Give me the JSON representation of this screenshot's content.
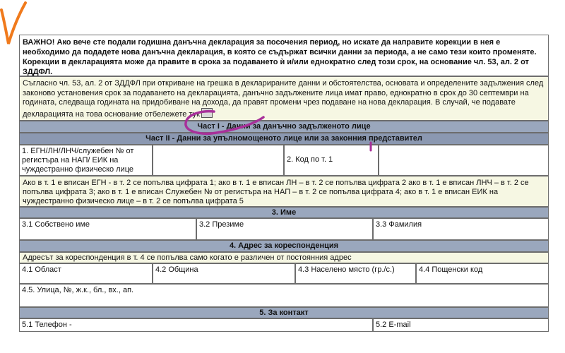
{
  "important": {
    "text": "ВАЖНО! Ако вече сте подали годишна данъчна декларация за посочения период, но искате да направите корекции в нея е необходимо да подадете нова данъчна декларация, в която се съдържат всички данни за периода, а не само тези които променяте. Корекции в декларацията може да правите в срока за подаването ѝ и/или еднократно след този срок, на основание чл. 53, ал. 2 от ЗДДФЛ."
  },
  "notice": {
    "text": "Съгласно чл. 53, ал. 2 от ЗДДФЛ при откриване на грешка в декларираните данни и обстоятелства, основата и определените задължения след законово установения срок за подаването на декларацията, данъчно задължените лица имат право, еднократно в срок до 30 септември на годината, следваща годината на придобиване на дохода, да правят промени чрез подаване на нова декларация. В случай, че подавате декларацията на това основание отбележете тук"
  },
  "headers": {
    "part1": "Част I - Данни за данъчно задълженото лице",
    "part2": "Част II - Данни за упълномощеното лице или за законния представител",
    "name": "3. Име",
    "address": "4. Адрес за кореспонденция",
    "contact": "5. За контакт"
  },
  "fields": {
    "egn_label": "1. ЕГН/ЛН/ЛНЧ/служебен № от регистъра на НАП/ ЕИК на чуждестранно физическо лице",
    "code_label": "2. Код по т. 1",
    "code_hint": "Ако в т. 1 е вписан ЕГН - в т. 2 се попълва цифрата 1; ако в т. 1 е вписан ЛН – в т. 2 се попълва цифрата 2 ако в т. 1 е вписан ЛНЧ – в т. 2 се попълва цифрата 3; ако в т. 1 е вписан Служебен № от регистъра на НАП – в т. 2 се попълва цифрата 4; ако в т. 1 е вписан ЕИК на чуждестранно физическо лице – в т. 2 се попълва цифрата 5",
    "first_name": "3.1 Собствено име",
    "middle_name": "3.2 Презиме",
    "last_name": "3.3 Фамилия",
    "address_hint": "Адресът за кореспонденция в т. 4 се попълва само когато е различен от постоянния адрес",
    "region": "4.1 Област",
    "municipality": "4.2 Община",
    "settlement": "4.3 Населено място (гр./с.)",
    "postcode": "4.4 Пощенски код",
    "street": "4.5. Улица, №, ж.к., бл., вх., ап.",
    "phone": "5.1 Телефон -",
    "email": "5.2 E-mail"
  }
}
